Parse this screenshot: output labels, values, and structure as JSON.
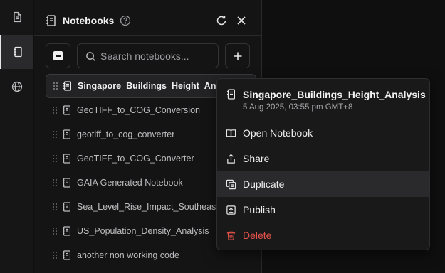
{
  "rail": {
    "items": [
      {
        "icon": "document-icon"
      },
      {
        "icon": "notebook-icon",
        "active": true
      },
      {
        "icon": "globe-icon"
      }
    ]
  },
  "panel": {
    "title": "Notebooks",
    "search_placeholder": "Search notebooks..."
  },
  "notebooks": [
    {
      "label": "Singapore_Buildings_Height_Analysis",
      "selected": true
    },
    {
      "label": "GeoTIFF_to_COG_Conversion"
    },
    {
      "label": "geotiff_to_cog_converter"
    },
    {
      "label": "GeoTIFF_to_COG_Converter"
    },
    {
      "label": "GAIA Generated Notebook"
    },
    {
      "label": "Sea_Level_Rise_Impact_Southeast_Asia"
    },
    {
      "label": "US_Population_Density_Analysis"
    },
    {
      "label": "another non working code"
    }
  ],
  "context_menu": {
    "title": "Singapore_Buildings_Height_Analysis",
    "timestamp": "5 Aug 2025, 03:55 pm GMT+8",
    "items": {
      "open": "Open Notebook",
      "share": "Share",
      "duplicate": "Duplicate",
      "publish": "Publish",
      "delete": "Delete"
    },
    "hovered": "Duplicate",
    "danger_color": "#e5534b"
  }
}
